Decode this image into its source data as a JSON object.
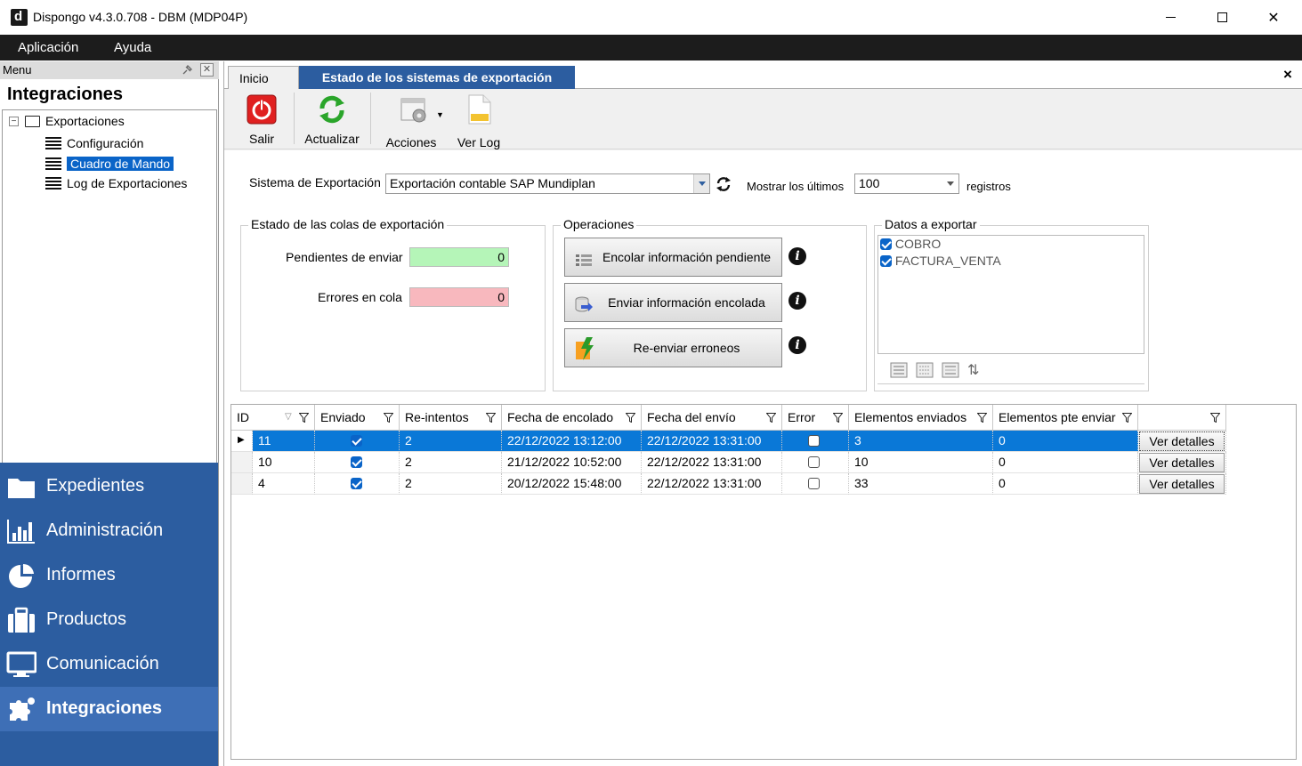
{
  "window": {
    "title": "Dispongo v4.3.0.708 - DBM (MDP04P)",
    "logo_letter": "d",
    "close_glyph": "✕"
  },
  "menubar": {
    "items": [
      "Aplicación",
      "Ayuda"
    ]
  },
  "left_panel": {
    "caption": "Menu",
    "header": "Integraciones",
    "tree": {
      "root": "Exportaciones",
      "root_expander": "−",
      "children": [
        "Configuración",
        "Cuadro de Mando",
        "Log de Exportaciones"
      ],
      "selected": "Cuadro de Mando"
    },
    "nav": [
      {
        "label": "Expedientes",
        "icon": "folder-icon"
      },
      {
        "label": "Administración",
        "icon": "bar-chart-icon"
      },
      {
        "label": "Informes",
        "icon": "pie-chart-icon"
      },
      {
        "label": "Productos",
        "icon": "briefcase-icon"
      },
      {
        "label": "Comunicación",
        "icon": "monitor-icon"
      },
      {
        "label": "Integraciones",
        "icon": "puzzle-icon",
        "active": true
      }
    ]
  },
  "tabs": [
    {
      "label": "Inicio"
    },
    {
      "label": "Estado de los sistemas de exportación",
      "active": true
    }
  ],
  "tab_close": "×",
  "toolbar": {
    "salir": "Salir",
    "actualizar": "Actualizar",
    "acciones": "Acciones",
    "ver_log": "Ver Log"
  },
  "filters": {
    "sistema_label": "Sistema de Exportación",
    "sistema_value": "Exportación contable SAP Mundiplan",
    "mostrar_label": "Mostrar los últimos",
    "mostrar_value": "100",
    "registros_label": "registros"
  },
  "colas": {
    "title": "Estado de las colas de exportación",
    "pendientes_label": "Pendientes de enviar",
    "pendientes_value": "0",
    "errores_label": "Errores en cola",
    "errores_value": "0"
  },
  "operaciones": {
    "title": "Operaciones",
    "encolar": "Encolar información pendiente",
    "enviar": "Enviar información encolada",
    "reenviar": "Re-enviar erroneos",
    "info_glyph": "i"
  },
  "datos": {
    "title": "Datos a exportar",
    "items": [
      "COBRO",
      "FACTURA_VENTA"
    ]
  },
  "grid": {
    "columns": [
      "ID",
      "Enviado",
      "Re-intentos",
      "Fecha de encolado",
      "Fecha del envío",
      "Error",
      "Elementos enviados",
      "Elementos pte enviar",
      ""
    ],
    "rows": [
      {
        "id": "11",
        "enviado": true,
        "reintentos": "2",
        "fecha_encolado": "22/12/2022 13:12:00",
        "fecha_envio": "22/12/2022 13:31:00",
        "error": false,
        "enviados": "3",
        "pendientes": "0",
        "action": "Ver detalles",
        "selected": true
      },
      {
        "id": "10",
        "enviado": true,
        "reintentos": "2",
        "fecha_encolado": "21/12/2022 10:52:00",
        "fecha_envio": "22/12/2022 13:31:00",
        "error": false,
        "enviados": "10",
        "pendientes": "0",
        "action": "Ver detalles"
      },
      {
        "id": "4",
        "enviado": true,
        "reintentos": "2",
        "fecha_encolado": "20/12/2022 15:48:00",
        "fecha_envio": "22/12/2022 13:31:00",
        "error": false,
        "enviados": "33",
        "pendientes": "0",
        "action": "Ver detalles"
      }
    ]
  },
  "colors": {
    "nav_bg": "#2c5da0",
    "nav_active": "#3e6fb6",
    "selection": "#0a78d7",
    "pending_field": "#b5f5b8",
    "error_field": "#f8b8be"
  }
}
